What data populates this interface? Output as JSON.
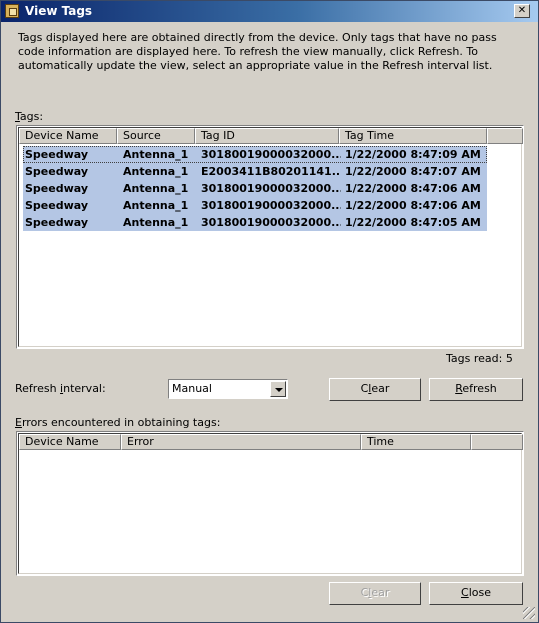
{
  "window": {
    "title": "View Tags"
  },
  "description": "Tags displayed here are obtained directly from the device. Only tags that have no pass code information are displayed here. To refresh the view manually, click Refresh. To automatically update the view, select an appropriate value in the Refresh interval list.",
  "tags": {
    "label_prefix": "",
    "label_u": "T",
    "label_rest": "ags:",
    "columns": [
      "Device Name",
      "Source",
      "Tag ID",
      "Tag Time"
    ],
    "rows": [
      [
        "Speedway",
        "Antenna_1",
        "30180019000032000...",
        "1/22/2000 8:47:09 AM"
      ],
      [
        "Speedway",
        "Antenna_1",
        "E2003411B80201141...",
        "1/22/2000 8:47:07 AM"
      ],
      [
        "Speedway",
        "Antenna_1",
        "30180019000032000...",
        "1/22/2000 8:47:06 AM"
      ],
      [
        "Speedway",
        "Antenna_1",
        "30180019000032000...",
        "1/22/2000 8:47:06 AM"
      ],
      [
        "Speedway",
        "Antenna_1",
        "30180019000032000...",
        "1/22/2000 8:47:05 AM"
      ]
    ],
    "tags_read": "Tags read: 5"
  },
  "refresh": {
    "label_prefix": "Refresh ",
    "label_u": "i",
    "label_rest": "nterval:",
    "selected": "Manual"
  },
  "buttons": {
    "clear_prefix": "C",
    "clear_u": "l",
    "clear_rest": "ear",
    "refresh_prefix": "",
    "refresh_u": "R",
    "refresh_rest": "efresh",
    "clear2_prefix": "C",
    "clear2_u": "l",
    "clear2_rest": "ear",
    "close_prefix": "",
    "close_u": "C",
    "close_rest": "lose"
  },
  "errors": {
    "label_prefix": "",
    "label_u": "E",
    "label_rest": "rrors encountered in obtaining tags:",
    "columns": [
      "Device Name",
      "Error",
      "Time"
    ]
  }
}
